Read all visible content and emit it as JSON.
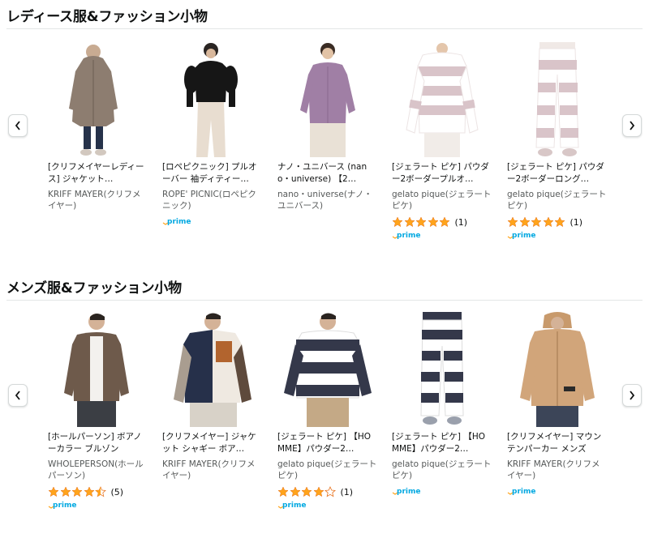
{
  "colors": {
    "star": "#ffa41c",
    "prime": "#00a8e1",
    "text": "#0f1111",
    "muted": "#565959"
  },
  "sections": [
    {
      "title": "レディース服&ファッション小物",
      "prev_icon": "chevron-left-icon",
      "next_icon": "chevron-right-icon",
      "products": [
        {
          "title": "[クリフメイヤーレディース] ジャケット…",
          "brand": "KRIFF MAYER(クリフメイヤー)",
          "prime": false,
          "image": "long-fleece-coat"
        },
        {
          "title": "[ロペピクニック] プルオーバー 袖ディティー…",
          "brand": "ROPE' PICNIC(ロペピクニック)",
          "prime": true,
          "image": "black-knit-top"
        },
        {
          "title": "ナノ・ユニバース (nano・universe) 【2…",
          "brand": "nano・universe(ナノ・ユニバース)",
          "prime": false,
          "image": "lavender-cardigan"
        },
        {
          "title": "[ジェラート ピケ] パウダー2ボーダープルオ…",
          "brand": "gelato pique(ジェラート ピケ)",
          "rating": 5,
          "rating_count": "(1)",
          "prime": true,
          "image": "striped-pullover"
        },
        {
          "title": "[ジェラート ピケ] パウダー2ボーダーロング…",
          "brand": "gelato pique(ジェラート ピケ)",
          "rating": 5,
          "rating_count": "(1)",
          "prime": true,
          "image": "striped-long-pants"
        }
      ]
    },
    {
      "title": "メンズ服&ファッション小物",
      "prev_icon": "chevron-left-icon",
      "next_icon": "chevron-right-icon",
      "products": [
        {
          "title": "[ホールパーソン] ボアノーカラー ブルゾン",
          "brand": "WHOLEPERSON(ホールパーソン)",
          "rating": 4.5,
          "rating_count": "(5)",
          "prime": true,
          "image": "boa-collarless-blouson"
        },
        {
          "title": "[クリフメイヤー] ジャケット シャギー ボア…",
          "brand": "KRIFF MAYER(クリフメイヤー)",
          "prime": false,
          "image": "patchwork-boa-jacket"
        },
        {
          "title": "[ジェラート ピケ] 【HOMME】パウダー2…",
          "brand": "gelato pique(ジェラート ピケ)",
          "rating": 4,
          "rating_count": "(1)",
          "prime": true,
          "image": "mens-striped-pullover"
        },
        {
          "title": "[ジェラート ピケ] 【HOMME】パウダー2…",
          "brand": "gelato pique(ジェラート ピケ)",
          "prime": true,
          "image": "mens-striped-pants"
        },
        {
          "title": "[クリフメイヤー] マウンテンパーカー メンズ",
          "brand": "KRIFF MAYER(クリフメイヤー)",
          "prime": true,
          "image": "beige-mountain-parka"
        }
      ]
    }
  ]
}
